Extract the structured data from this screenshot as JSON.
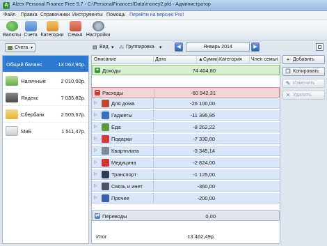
{
  "window": {
    "title": "Alzex Personal Finance Free 5.7 - C:\\PersonalFinances\\Data\\money2.pfd - Администратор",
    "app_glyph": "A"
  },
  "menu": {
    "items": [
      "Файл",
      "Правка",
      "Справочники",
      "Инструменты",
      "Помощь"
    ],
    "link": "Перейти на версию Pro!"
  },
  "toolbar": {
    "buttons": [
      {
        "label": "Валюты",
        "icon": "currency-icon",
        "color": "#3c9a3c"
      },
      {
        "label": "Счета",
        "icon": "accounts-icon",
        "color": "#4f87c9"
      },
      {
        "label": "Категории",
        "icon": "categories-icon",
        "color": "#d9922e"
      },
      {
        "label": "Семья",
        "icon": "family-icon",
        "color": "#c8553d"
      },
      {
        "label": "Настройки",
        "icon": "settings-icon",
        "color": "#6b7f95"
      }
    ]
  },
  "accounts": {
    "button_label": "Счета",
    "list": [
      {
        "name": "Общий баланс",
        "value": "13 062,96р.",
        "selected": true,
        "icon_color": ""
      },
      {
        "name": "Наличные",
        "value": "2 010,00р.",
        "selected": false,
        "icon_color": "#6aa84f"
      },
      {
        "name": "Яндекс",
        "value": "7 035,82р.",
        "selected": false,
        "icon_color": "#4a4a4a"
      },
      {
        "name": "Сбербанк",
        "value": "2 505,67р.",
        "selected": false,
        "icon_color": "#e8b23a"
      },
      {
        "name": "МиБ",
        "value": "1 511,47р.",
        "selected": false,
        "icon_color": "#e0e4ea"
      }
    ]
  },
  "center_toolbar": {
    "view_label": "Вид",
    "group_label": "Группировка",
    "month": "Январь 2014",
    "prev": "◀",
    "next": "▶"
  },
  "grid": {
    "headers": {
      "description": "Описание",
      "date": "Дата",
      "sum": "Сумма",
      "category": "Категория",
      "member": "Член семьи"
    },
    "income": {
      "label": "Доходы",
      "amount": "74 404,80",
      "sign": "+"
    },
    "expense": {
      "label": "Расходы",
      "amount": "-60 942,31",
      "sign": "−"
    },
    "categories": [
      {
        "name": "Для дома",
        "amount": "-26 100,00",
        "icon": "home-icon",
        "color": "#c0472e"
      },
      {
        "name": "Гаджеты",
        "amount": "-11 395,95",
        "icon": "gadgets-icon",
        "color": "#3b6fb6"
      },
      {
        "name": "Еда",
        "amount": "-8 262,22",
        "icon": "food-icon",
        "color": "#5a9a3a"
      },
      {
        "name": "Подарки",
        "amount": "-7 330,00",
        "icon": "gift-icon",
        "color": "#d23d3d"
      },
      {
        "name": "Квартплата",
        "amount": "-3 345,14",
        "icon": "rent-icon",
        "color": "#7f8b99"
      },
      {
        "name": "Медицина",
        "amount": "-2 824,00",
        "icon": "medicine-icon",
        "color": "#c33"
      },
      {
        "name": "Транспорт",
        "amount": "-1 125,00",
        "icon": "transport-icon",
        "color": "#2f3f55"
      },
      {
        "name": "Связь и инет",
        "amount": "-360,00",
        "icon": "phone-icon",
        "color": "#4b5563"
      },
      {
        "name": "Прочее",
        "amount": "-200,00",
        "icon": "other-icon",
        "color": "#3a5fa8"
      }
    ],
    "transfers": {
      "label": "Переводы",
      "amount": "0,00"
    },
    "total": {
      "label": "Итог",
      "amount": "13 462,49р."
    }
  },
  "actions": [
    {
      "label": "Добавить",
      "icon": "add-icon",
      "glyph": "+",
      "enabled": true,
      "color": "#2e8b2e"
    },
    {
      "label": "Копировать",
      "icon": "copy-icon",
      "glyph": "❐",
      "enabled": true,
      "color": "#4a6a90"
    },
    {
      "label": "Изменить",
      "icon": "edit-icon",
      "glyph": "✎",
      "enabled": false,
      "color": "#9aa5b2"
    },
    {
      "label": "Удалить",
      "icon": "delete-icon",
      "glyph": "✕",
      "enabled": false,
      "color": "#9aa5b2"
    }
  ]
}
